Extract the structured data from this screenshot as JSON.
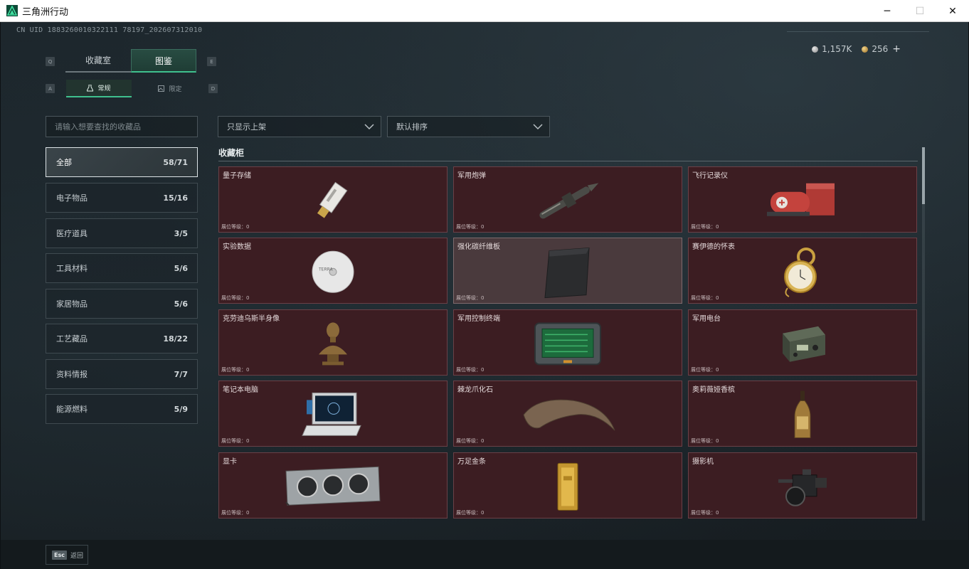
{
  "window": {
    "title": "三角洲行动",
    "minimize": "─",
    "maximize": "☐",
    "close": "✕"
  },
  "header": {
    "uid": "CN UID 1883260010322111 78197_202607312010",
    "currency": {
      "silver": "1,157K",
      "gold": "256",
      "add": "+"
    }
  },
  "tabs": {
    "prev_key": "Q",
    "next_key": "E",
    "items": [
      "收藏室",
      "图鉴"
    ],
    "active": "图鉴"
  },
  "subtabs": {
    "prev_key": "A",
    "next_key": "D",
    "items": [
      "常规",
      "限定"
    ]
  },
  "search": {
    "placeholder": "请输入想要查找的收藏品"
  },
  "categories": [
    {
      "label": "全部",
      "count": "58/71"
    },
    {
      "label": "电子物品",
      "count": "15/16"
    },
    {
      "label": "医疗道具",
      "count": "3/5"
    },
    {
      "label": "工具材料",
      "count": "5/6"
    },
    {
      "label": "家居物品",
      "count": "5/6"
    },
    {
      "label": "工艺藏品",
      "count": "18/22"
    },
    {
      "label": "资料情报",
      "count": "7/7"
    },
    {
      "label": "能源燃料",
      "count": "5/9"
    }
  ],
  "filters": {
    "show": "只显示上架",
    "sort": "默认排序"
  },
  "section": {
    "title": "收藏柜"
  },
  "items": [
    {
      "name": "量子存储",
      "level": "展位等级：0",
      "icon": "usb-drive-icon"
    },
    {
      "name": "军用炮弹",
      "level": "展位等级：0",
      "icon": "artillery-shell-icon"
    },
    {
      "name": "飞行记录仪",
      "level": "展位等级：0",
      "icon": "flight-recorder-icon"
    },
    {
      "name": "实验数据",
      "level": "展位等级：0",
      "icon": "disc-icon"
    },
    {
      "name": "强化碳纤维板",
      "level": "展位等级：0",
      "icon": "carbon-plate-icon"
    },
    {
      "name": "赛伊德的怀表",
      "level": "展位等级：0",
      "icon": "pocket-watch-icon"
    },
    {
      "name": "克劳迪乌斯半身像",
      "level": "展位等级：0",
      "icon": "bust-icon"
    },
    {
      "name": "军用控制终端",
      "level": "展位等级：0",
      "icon": "control-terminal-icon"
    },
    {
      "name": "军用电台",
      "level": "展位等级：0",
      "icon": "radio-icon"
    },
    {
      "name": "笔记本电脑",
      "level": "展位等级：0",
      "icon": "laptop-icon"
    },
    {
      "name": "棘龙爪化石",
      "level": "展位等级：0",
      "icon": "claw-fossil-icon"
    },
    {
      "name": "奥莉薇娅香槟",
      "level": "展位等级：0",
      "icon": "champagne-icon"
    },
    {
      "name": "显卡",
      "level": "展位等级：0",
      "icon": "graphics-card-icon"
    },
    {
      "name": "万足金条",
      "level": "展位等级：0",
      "icon": "gold-bar-icon"
    },
    {
      "name": "摄影机",
      "level": "展位等级：0",
      "icon": "camera-icon"
    }
  ],
  "footer": {
    "esc_key": "Esc",
    "back": "返回"
  },
  "colors": {
    "accent": "#3fc08e",
    "card_bg": "#3c1d22",
    "card_border": "#6a4047"
  }
}
